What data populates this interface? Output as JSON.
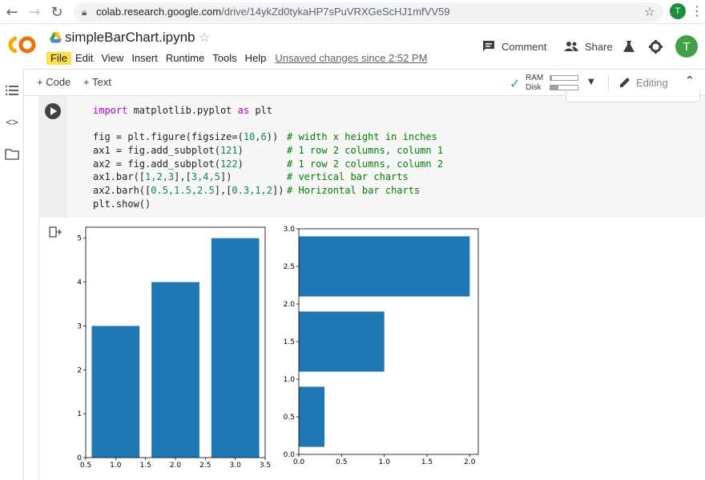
{
  "browser": {
    "url_host": "colab.research.google.com",
    "url_path": "/drive/14ykZd0tykaHP7sPuVRXGeScHJ1mfVV59",
    "profile_initial": "T",
    "icons": [
      "back-arrow-icon",
      "forward-arrow-icon",
      "reload-icon",
      "lock-icon",
      "bookmark-star-icon",
      "kebab-menu-icon"
    ]
  },
  "header": {
    "logo": "CO",
    "notebook_title": "simpleBarChart.ipynb",
    "menu": [
      "File",
      "Edit",
      "View",
      "Insert",
      "Runtime",
      "Tools",
      "Help"
    ],
    "active_menu": "File",
    "unsaved_text": "Unsaved changes since 2:52 PM",
    "comment_label": "Comment",
    "share_label": "Share",
    "user_initial": "T",
    "colors": {
      "logo_orange": "#f9ab00",
      "avatar_green": "#43a047",
      "active_menu_bg": "#fce14b"
    }
  },
  "toolbar": {
    "add_code_label": "+ Code",
    "add_text_label": "+ Text",
    "ram_label": "RAM",
    "disk_label": "Disk",
    "ram_fraction": 0.05,
    "disk_fraction": 0.3,
    "editing_label": "Editing"
  },
  "cell": {
    "code": {
      "line1_kw1": "import",
      "line1_mod": " matplotlib.pyplot ",
      "line1_kw2": "as",
      "line1_alias": " plt",
      "line3_a": "fig = plt.figure(figsize=(",
      "line3_n1": "10",
      "line3_b": ",",
      "line3_n2": "6",
      "line3_c": "))",
      "line3_comment": "# width x height in inches",
      "line4_a": "ax1 = fig.add_subplot(",
      "line4_n": "121",
      "line4_b": ")",
      "line4_comment": "# 1 row 2 columns, column 1",
      "line5_a": "ax2 = fig.add_subplot(",
      "line5_n": "122",
      "line5_b": ")",
      "line5_comment": "# 1 row 2 columns, column 2",
      "line6_a": "ax1.bar([",
      "line6_n": "1,2,3",
      "line6_b": "],[",
      "line6_n2": "3,4,5",
      "line6_c": "])",
      "line6_comment": "# vertical bar charts",
      "line7_a": "ax2.barh([",
      "line7_n": "0.5,1.5,2.5",
      "line7_b": "],[",
      "line7_n2": "0.3,1,2",
      "line7_c": "])",
      "line7_comment": "# Horizontal bar charts",
      "line8": "plt.show()"
    }
  },
  "chart_data": [
    {
      "type": "bar",
      "x": [
        1,
        2,
        3
      ],
      "values": [
        3,
        4,
        5
      ],
      "xlim": [
        0.5,
        3.5
      ],
      "ylim": [
        0,
        5.25
      ],
      "xticks": [
        "0.5",
        "1.0",
        "1.5",
        "2.0",
        "2.5",
        "3.0",
        "3.5"
      ],
      "yticks": [
        "0",
        "1",
        "2",
        "3",
        "4",
        "5"
      ],
      "color": "#1f77b4"
    },
    {
      "type": "barh",
      "y": [
        0.5,
        1.5,
        2.5
      ],
      "values": [
        0.3,
        1,
        2
      ],
      "xlim": [
        0,
        2.1
      ],
      "ylim": [
        0,
        3.0
      ],
      "xticks": [
        "0.0",
        "0.5",
        "1.0",
        "1.5",
        "2.0"
      ],
      "yticks": [
        "0.0",
        "0.5",
        "1.0",
        "1.5",
        "2.0",
        "2.5",
        "3.0"
      ],
      "color": "#1f77b4"
    }
  ]
}
